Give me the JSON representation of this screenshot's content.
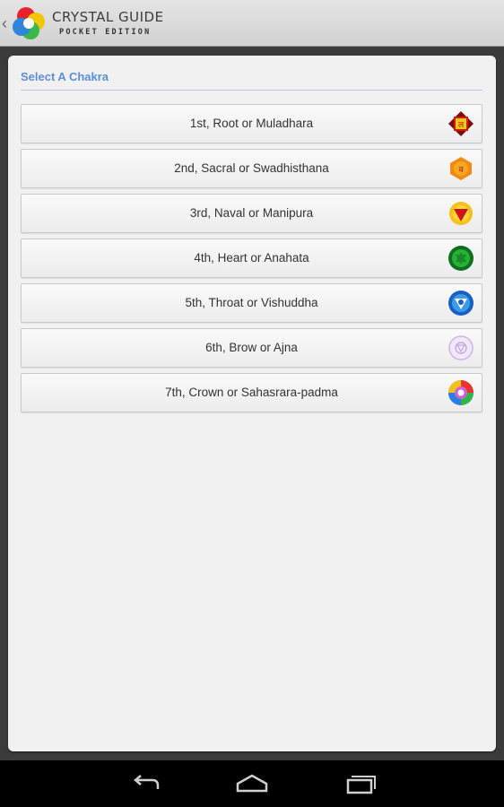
{
  "app": {
    "title": "CRYSTAL GUIDE",
    "subtitle": "POCKET EDITION"
  },
  "section": {
    "header": "Select A Chakra"
  },
  "chakras": [
    {
      "label": "1st, Root or Muladhara",
      "icon": "root-chakra-icon",
      "color": "#b0170e"
    },
    {
      "label": "2nd, Sacral or Swadhisthana",
      "icon": "sacral-chakra-icon",
      "color": "#f08a10"
    },
    {
      "label": "3rd, Naval or Manipura",
      "icon": "manipura-chakra-icon",
      "color": "#f5c21a"
    },
    {
      "label": "4th, Heart or Anahata",
      "icon": "heart-chakra-icon",
      "color": "#1c9a2a"
    },
    {
      "label": "5th, Throat or Vishuddha",
      "icon": "throat-chakra-icon",
      "color": "#1f78d6"
    },
    {
      "label": "6th, Brow or Ajna",
      "icon": "brow-chakra-icon",
      "color": "#c9b3e6"
    },
    {
      "label": "7th, Crown or Sahasrara-padma",
      "icon": "crown-chakra-icon",
      "color": "#9a3fd0"
    }
  ],
  "navbar": {
    "buttons": [
      "back-icon",
      "home-icon",
      "recent-apps-icon"
    ]
  }
}
